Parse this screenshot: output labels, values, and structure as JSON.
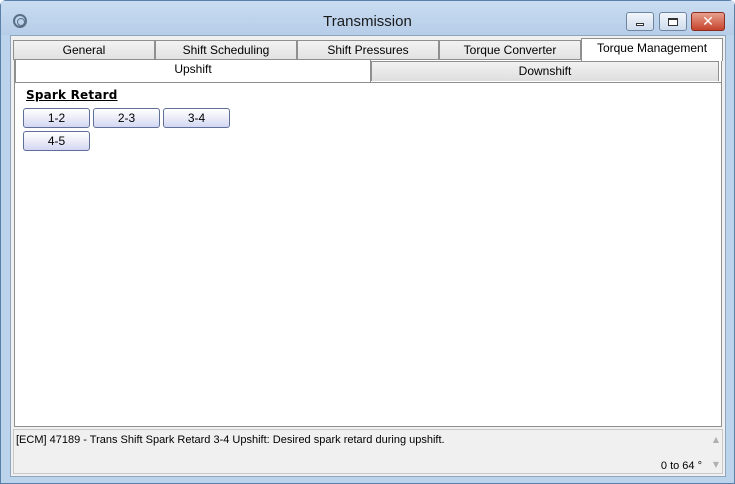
{
  "window": {
    "title": "Transmission"
  },
  "main_tabs": [
    {
      "label": "General"
    },
    {
      "label": "Shift Scheduling"
    },
    {
      "label": "Shift Pressures"
    },
    {
      "label": "Torque Converter"
    },
    {
      "label": "Torque Management",
      "active": true
    }
  ],
  "sub_tabs": [
    {
      "label": "Upshift",
      "active": true
    },
    {
      "label": "Downshift"
    }
  ],
  "section": {
    "heading": "Spark Retard",
    "buttons": [
      {
        "label": "1-2"
      },
      {
        "label": "2-3"
      },
      {
        "label": "3-4"
      },
      {
        "label": "4-5"
      }
    ]
  },
  "status": {
    "description": "[ECM] 47189 - Trans Shift Spark Retard 3-4 Upshift: Desired spark retard during upshift.",
    "range": "0 to 64 °"
  },
  "icons": {
    "app": "gear-icon",
    "minimize": "minimize-icon",
    "maximize": "maximize-icon",
    "close": "close-icon",
    "scroll_up": "arrow-up-icon",
    "scroll_down": "arrow-down-icon"
  }
}
